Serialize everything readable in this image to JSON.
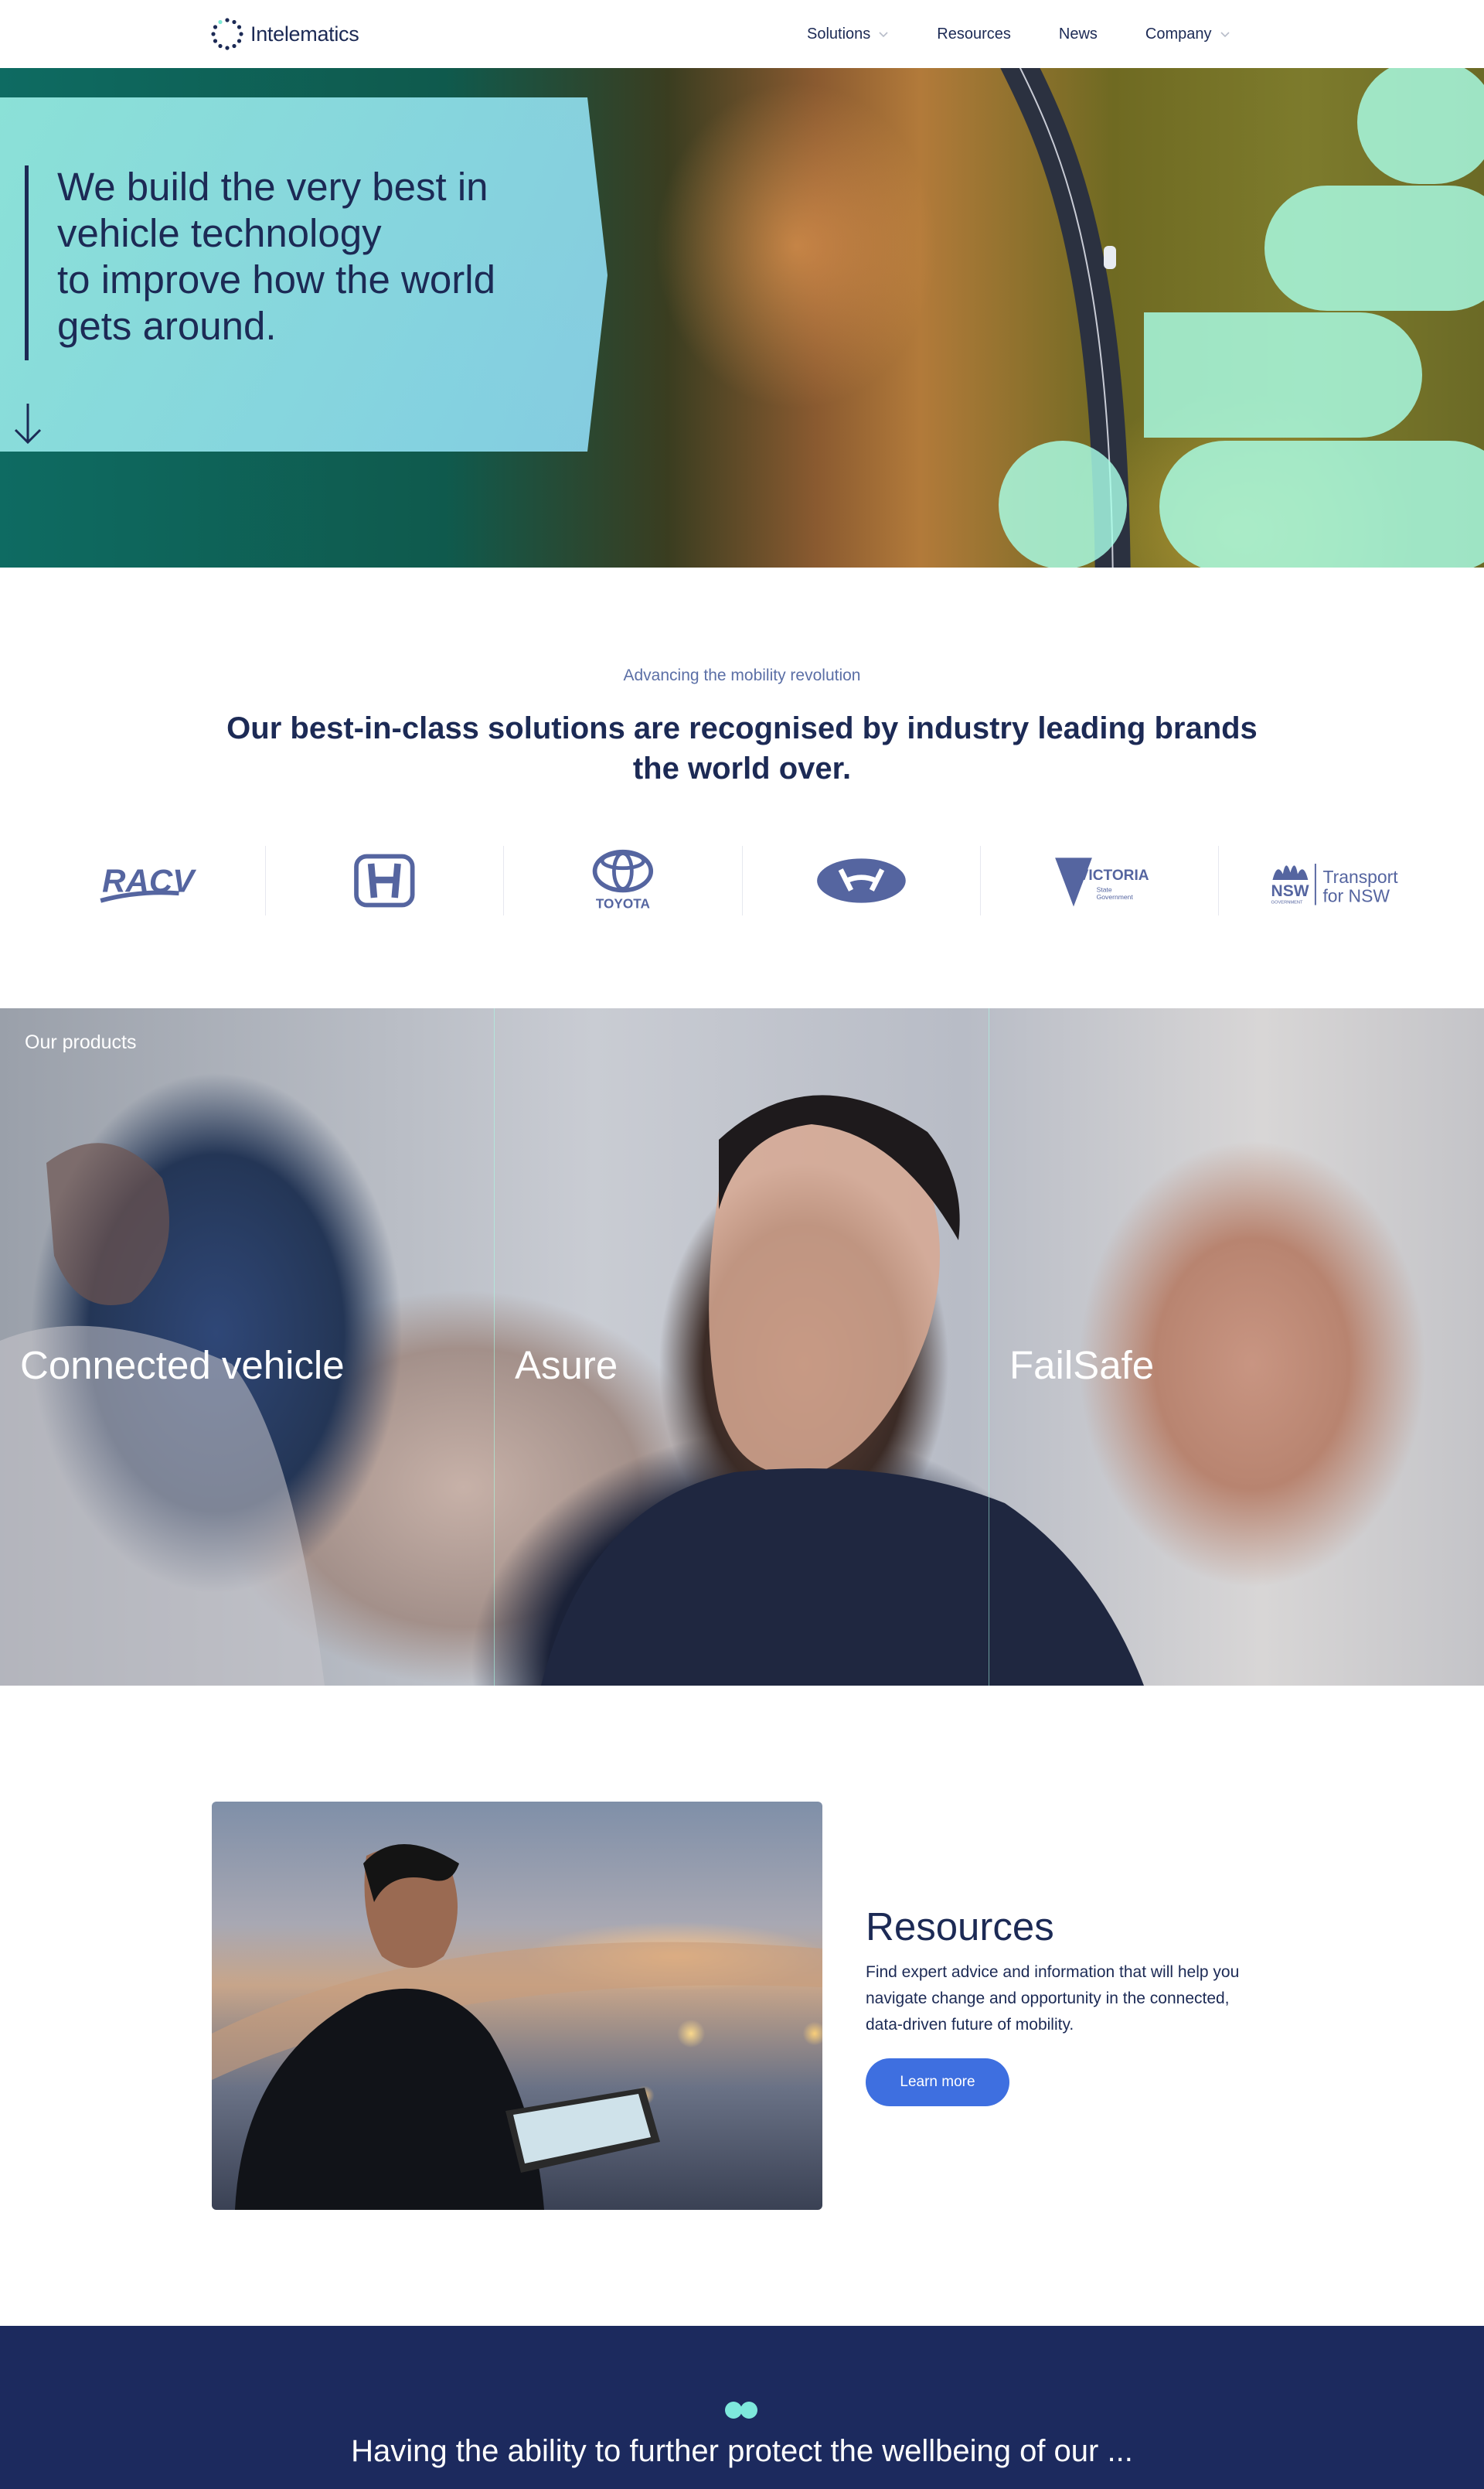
{
  "header": {
    "logo_text": "Intelematics",
    "nav": [
      {
        "label": "Solutions",
        "has_dropdown": true
      },
      {
        "label": "Resources",
        "has_dropdown": false
      },
      {
        "label": "News",
        "has_dropdown": false
      },
      {
        "label": "Company",
        "has_dropdown": true
      }
    ]
  },
  "hero": {
    "title_lines": [
      "We build the very best in",
      "vehicle technology",
      "to improve how the world",
      "gets around."
    ]
  },
  "intro": {
    "eyebrow": "Advancing the mobility revolution",
    "heading": "Our best-in-class solutions are recognised by industry leading brands the world over."
  },
  "brands": [
    {
      "name": "RACV",
      "icon": "racv-logo"
    },
    {
      "name": "Honda",
      "icon": "honda-logo"
    },
    {
      "name": "TOYOTA",
      "icon": "toyota-logo"
    },
    {
      "name": "Hyundai",
      "icon": "hyundai-logo"
    },
    {
      "name": "VICTORIA",
      "sub": [
        "State",
        "Government"
      ],
      "icon": "victoria-logo"
    },
    {
      "name": "NSW",
      "sub": [
        "Transport",
        "for NSW"
      ],
      "small": "GOVERNMENT",
      "icon": "transport-nsw-logo"
    }
  ],
  "products": {
    "label": "Our products",
    "items": [
      "Connected vehicle",
      "Asure",
      "FailSafe"
    ]
  },
  "resources": {
    "title": "Resources",
    "text": "Find expert advice and information that will help you navigate change and opportunity in the connected, data-driven future of mobility.",
    "button": "Learn more"
  },
  "band": {
    "text": "Having the ability to further protect the wellbeing of our ..."
  },
  "colors": {
    "navy": "#1c2a55",
    "accent_blue": "#3e6fe0",
    "mint": "#aaffe8",
    "band": "#1c2a5e"
  }
}
